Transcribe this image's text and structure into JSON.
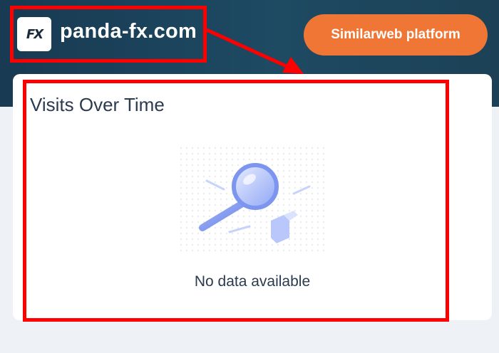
{
  "header": {
    "site_logo_text": "FX",
    "site_name": "panda-fx.com",
    "platform_button_label": "Similarweb platform"
  },
  "card": {
    "title": "Visits Over Time",
    "empty_message": "No data available"
  },
  "colors": {
    "header_bg": "#1e4a63",
    "accent_orange": "#f07636",
    "annotation_red": "#ff0000",
    "text_dark": "#2b3a4f"
  },
  "icons": [
    "magnifier-icon"
  ]
}
